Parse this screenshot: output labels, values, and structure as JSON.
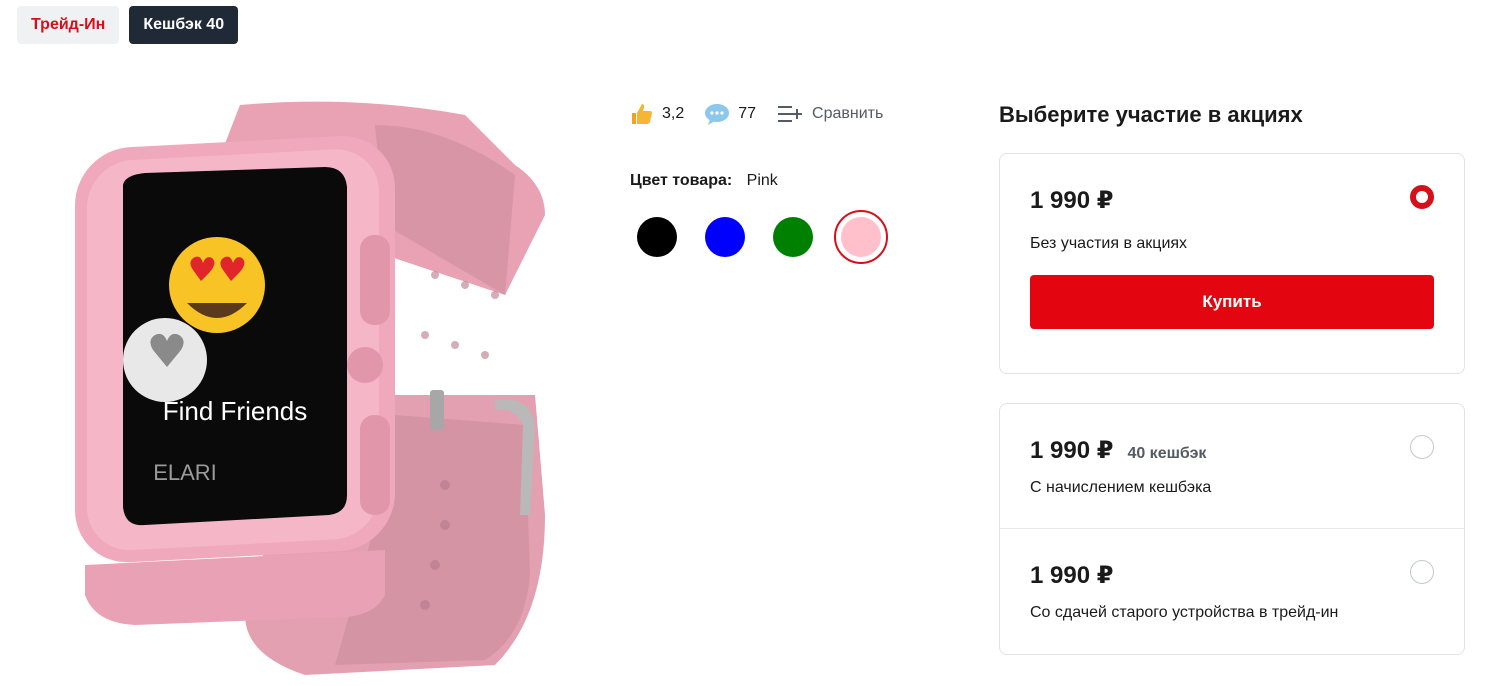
{
  "tags": [
    {
      "label": "Трейд-Ин"
    },
    {
      "label": "Кешбэк 40"
    }
  ],
  "product": {
    "image_screen_text": "Find Friends",
    "image_brand_text": "ELARI",
    "rating": "3,2",
    "reviews": "77",
    "compare_label": "Сравнить",
    "color_label": "Цвет товара:",
    "color_value": "Pink",
    "colors": [
      {
        "name": "black",
        "hex": "#000000"
      },
      {
        "name": "blue",
        "hex": "#0000ff"
      },
      {
        "name": "green",
        "hex": "#008000"
      },
      {
        "name": "pink",
        "hex": "#ffc0cb",
        "selected": true
      }
    ]
  },
  "promo": {
    "title": "Выберите участие в акциях",
    "options": [
      {
        "price": "1 990 ₽",
        "cashback": "",
        "desc": "Без участия в акциях",
        "selected": true
      },
      {
        "price": "1 990 ₽",
        "cashback": "40 кешбэк",
        "desc": "С начислением кешбэка",
        "selected": false
      },
      {
        "price": "1 990 ₽",
        "cashback": "",
        "desc": "Со сдачей старого устройства в трейд-ин",
        "selected": false
      }
    ],
    "buy_label": "Купить"
  },
  "theme": {
    "accent": "#e30611",
    "dark": "#202a36"
  }
}
